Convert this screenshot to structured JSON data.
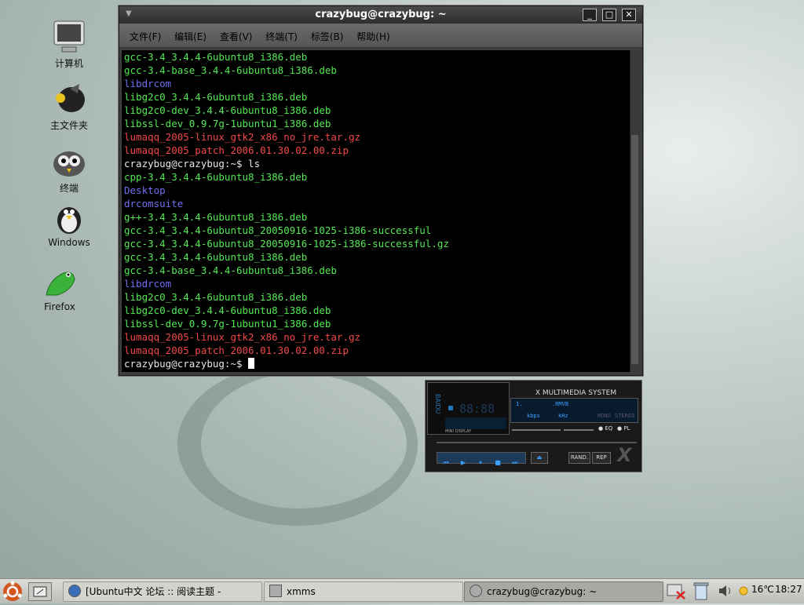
{
  "desktop": {
    "icons": [
      {
        "label": "计算机",
        "icon": "computer-icon"
      },
      {
        "label": "主文件夹",
        "icon": "home-folder-icon"
      },
      {
        "label": "终端",
        "icon": "terminal-icon"
      },
      {
        "label": "Windows",
        "icon": "windows-drive-icon"
      },
      {
        "label": "Firefox",
        "icon": "firefox-icon"
      }
    ]
  },
  "terminal": {
    "title": "crazybug@crazybug: ~",
    "menu": [
      "文件(F)",
      "编辑(E)",
      "查看(V)",
      "终端(T)",
      "标签(B)",
      "帮助(H)"
    ],
    "lines": [
      {
        "text": "gcc-3.4_3.4.4-6ubuntu8_i386.deb",
        "color": "#55e855"
      },
      {
        "text": "gcc-3.4-base_3.4.4-6ubuntu8_i386.deb",
        "color": "#55e855"
      },
      {
        "text": "libdrcom",
        "color": "#6e6ef0"
      },
      {
        "text": "libg2c0_3.4.4-6ubuntu8_i386.deb",
        "color": "#55e855"
      },
      {
        "text": "libg2c0-dev_3.4.4-6ubuntu8_i386.deb",
        "color": "#55e855"
      },
      {
        "text": "libssl-dev_0.9.7g-1ubuntu1_i386.deb",
        "color": "#55e855"
      },
      {
        "text": "lumaqq_2005-linux_gtk2_x86_no_jre.tar.gz",
        "color": "#f04848"
      },
      {
        "text": "lumaqq_2005_patch_2006.01.30.02.00.zip",
        "color": "#f04848"
      },
      {
        "text": "crazybug@crazybug:~$ ls",
        "color": "#e8e8e8"
      },
      {
        "text": "cpp-3.4_3.4.4-6ubuntu8_i386.deb",
        "color": "#55e855"
      },
      {
        "text": "Desktop",
        "color": "#6e6ef0"
      },
      {
        "text": "drcomsuite",
        "color": "#6e6ef0"
      },
      {
        "text": "g++-3.4_3.4.4-6ubuntu8_i386.deb",
        "color": "#55e855"
      },
      {
        "text": "gcc-3.4_3.4.4-6ubuntu8_20050916-1025-i386-successful",
        "color": "#55e855"
      },
      {
        "text": "gcc-3.4_3.4.4-6ubuntu8_20050916-1025-i386-successful.gz",
        "color": "#55e855"
      },
      {
        "text": "gcc-3.4_3.4.4-6ubuntu8_i386.deb",
        "color": "#55e855"
      },
      {
        "text": "gcc-3.4-base_3.4.4-6ubuntu8_i386.deb",
        "color": "#55e855"
      },
      {
        "text": "libdrcom",
        "color": "#6e6ef0"
      },
      {
        "text": "libg2c0_3.4.4-6ubuntu8_i386.deb",
        "color": "#55e855"
      },
      {
        "text": "libg2c0-dev_3.4.4-6ubuntu8_i386.deb",
        "color": "#55e855"
      },
      {
        "text": "libssl-dev_0.9.7g-1ubuntu1_i386.deb",
        "color": "#55e855"
      },
      {
        "text": "lumaqq_2005-linux_gtk2_x86_no_jre.tar.gz",
        "color": "#f04848"
      },
      {
        "text": "lumaqq_2005_patch_2006.01.30.02.00.zip",
        "color": "#f04848"
      }
    ],
    "prompt": "crazybug@crazybug:~$"
  },
  "xmms": {
    "header": "X MULTIMEDIA SYSTEM",
    "side_label": "BAIDU",
    "time": "88:88",
    "track": "1.",
    "format": ".RMVB",
    "kbps": "kbps",
    "khz": "kHz",
    "mini_display": "MINI DISPLAY",
    "eq_label": "EQ",
    "pl_label": "PL",
    "rand_label": "RAND.",
    "rep_label": "REP",
    "mono_label": "MONO",
    "stereo_label": "STEREO"
  },
  "taskbar": {
    "tasks": [
      {
        "label": "[Ubuntu中文 论坛 :: 阅读主题 -",
        "icon": "firefox-icon"
      },
      {
        "label": "xmms",
        "icon": "xmms-icon"
      },
      {
        "label": "crazybug@crazybug: ~",
        "icon": "terminal-icon"
      }
    ],
    "temperature": "16℃",
    "clock": "18:27"
  }
}
